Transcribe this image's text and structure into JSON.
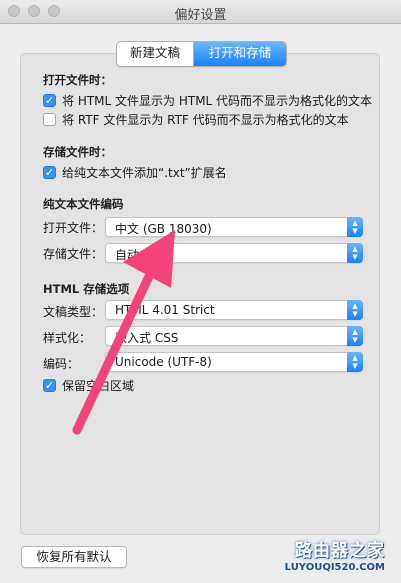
{
  "window": {
    "title": "偏好设置"
  },
  "tabs": [
    {
      "label": "新建文稿",
      "active": false
    },
    {
      "label": "打开和存储",
      "active": true
    }
  ],
  "open_section": {
    "title": "打开文件时：",
    "options": [
      {
        "label": "将 HTML 文件显示为 HTML 代码而不显示为格式化的文本",
        "checked": true
      },
      {
        "label": "将 RTF 文件显示为 RTF 代码而不显示为格式化的文本",
        "checked": false
      }
    ]
  },
  "save_section": {
    "title": "存储文件时：",
    "options": [
      {
        "label": "给纯文本文件添加“.txt”扩展名",
        "checked": true
      }
    ]
  },
  "encoding_section": {
    "title": "纯文本文件编码",
    "open_label": "打开文件：",
    "open_value": "中文 (GB 18030)",
    "save_label": "存储文件：",
    "save_value": "自动"
  },
  "html_section": {
    "title": "HTML 存储选项",
    "doctype_label": "文稿类型：",
    "doctype_value": "HTML 4.01 Strict",
    "style_label": "样式化：",
    "style_value": "嵌入式 CSS",
    "encoding_label": "编码：",
    "encoding_value": "Unicode (UTF-8)",
    "preserve_label": "保留空白区域",
    "preserve_checked": true
  },
  "footer": {
    "restore_label": "恢复所有默认"
  },
  "watermark": {
    "cn": "路由器之家",
    "en": "LUYOUQI520.COM"
  },
  "colors": {
    "accent": "#1a82f7",
    "annotation_arrow": "#f2447a"
  },
  "icons": {
    "check": "✓",
    "select_arrows": "▲▼"
  }
}
